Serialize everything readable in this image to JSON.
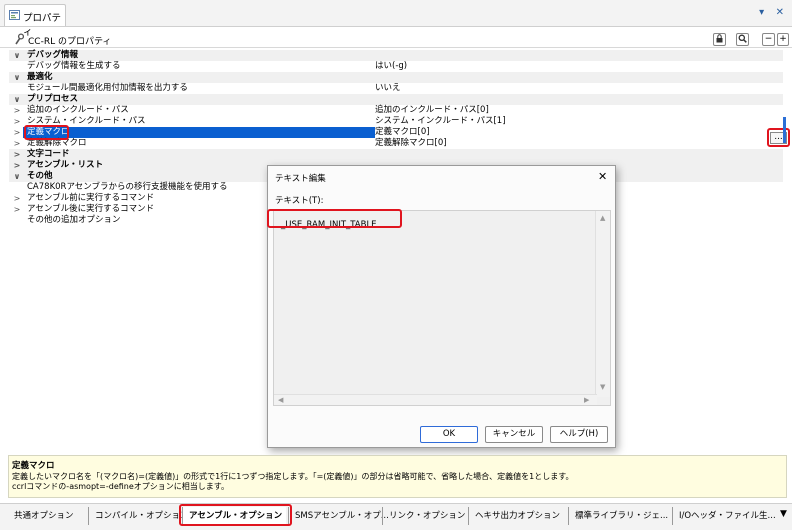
{
  "window": {
    "tab_title": "プロパティ",
    "controls": "▾ ✕"
  },
  "header": {
    "title": "CC-RL のプロパティ",
    "buttons": {
      "lock": "🔒",
      "search": "🔍",
      "minus": "−",
      "plus": "+"
    }
  },
  "grid": {
    "rows": [
      {
        "type": "cat",
        "expander": "∨",
        "name": "デバッグ情報",
        "value": ""
      },
      {
        "type": "prop",
        "expander": "",
        "name": "デバッグ情報を生成する",
        "value": "はい(-g)"
      },
      {
        "type": "cat",
        "expander": "∨",
        "name": "最適化",
        "value": ""
      },
      {
        "type": "prop",
        "expander": "",
        "name": "モジュール間最適化用付加情報を出力する",
        "value": "いいえ"
      },
      {
        "type": "cat",
        "expander": "∨",
        "name": "プリプロセス",
        "value": ""
      },
      {
        "type": "prop",
        "expander": ">",
        "name": "追加のインクルード・パス",
        "value": "追加のインクルード・パス[0]"
      },
      {
        "type": "prop",
        "expander": ">",
        "name": "システム・インクルード・パス",
        "value": "システム・インクルード・パス[1]"
      },
      {
        "type": "sel",
        "expander": ">",
        "name": "定義マクロ",
        "value": "定義マクロ[0]"
      },
      {
        "type": "prop",
        "expander": ">",
        "name": "定義解除マクロ",
        "value": "定義解除マクロ[0]"
      },
      {
        "type": "cat",
        "expander": ">",
        "name": "文字コード",
        "value": ""
      },
      {
        "type": "cat",
        "expander": ">",
        "name": "アセンブル・リスト",
        "value": ""
      },
      {
        "type": "cat",
        "expander": "∨",
        "name": "その他",
        "value": ""
      },
      {
        "type": "prop",
        "expander": "",
        "name": "CA78K0Rアセンブラからの移行支援機能を使用する",
        "value": ""
      },
      {
        "type": "prop",
        "expander": ">",
        "name": "アセンブル前に実行するコマンド",
        "value": ""
      },
      {
        "type": "prop",
        "expander": ">",
        "name": "アセンブル後に実行するコマンド",
        "value": ""
      },
      {
        "type": "prop",
        "expander": "",
        "name": "その他の追加オプション",
        "value": ""
      }
    ],
    "ellipsis": "..."
  },
  "dialog": {
    "title": "テキスト編集",
    "close": "✕",
    "label": "テキスト(T):",
    "text": "_USE_RAM_INIT_TABLE",
    "ok": "OK",
    "cancel": "キャンセル",
    "help": "ヘルプ(H)"
  },
  "description": {
    "title": "定義マクロ",
    "line1": "定義したいマクロ名を「(マクロ名)=(定義値)」の形式で1行に1つずつ指定します。「=(定義値)」の部分は省略可能で、省略した場合、定義値を1とします。",
    "line2": "ccrlコマンドの-asmopt=-defineオプションに相当します。"
  },
  "bottom_tabs": [
    {
      "label": "共通オプション",
      "active": false
    },
    {
      "label": "コンパイル・オプション",
      "active": false
    },
    {
      "label": "アセンブル・オプション",
      "active": true
    },
    {
      "label": "SMSアセンブル・オプ...",
      "active": false
    },
    {
      "label": "リンク・オプション",
      "active": false
    },
    {
      "label": "ヘキサ出力オプション",
      "active": false
    },
    {
      "label": "標準ライブラリ・ジェ...",
      "active": false
    },
    {
      "label": "I/Oヘッダ・ファイル生...",
      "active": false
    }
  ],
  "tab_more": "▼",
  "colors": {
    "selection": "#0a5fd0",
    "highlight": "#e0141e",
    "description_bg": "#fffde0"
  }
}
